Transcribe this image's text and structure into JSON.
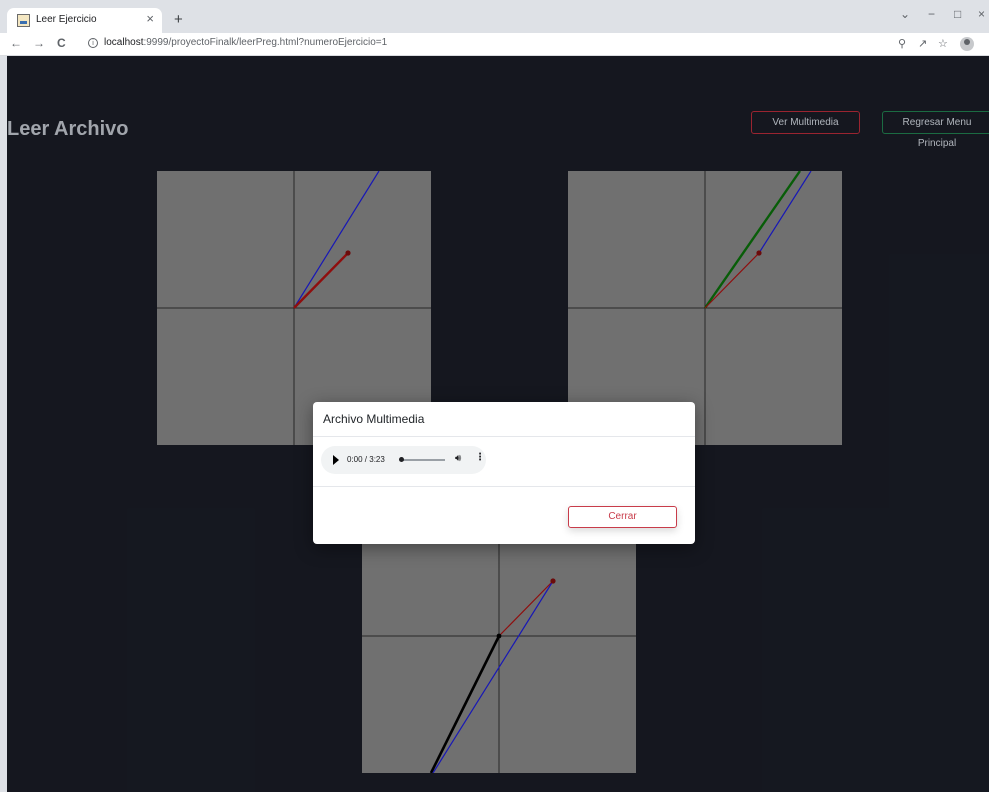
{
  "browser": {
    "tab_title": "Leer Ejercicio",
    "tab_close": "×",
    "new_tab": "+",
    "url_host": "localhost",
    "url_rest": ":9999/proyectoFinalk/leerPreg.html?numeroEjercicio=1",
    "controls": {
      "minimize": "−",
      "maximize": "□",
      "close": "×",
      "dropdown": "⌄"
    },
    "nav": {
      "back": "←",
      "forward": "→",
      "reload": "C"
    }
  },
  "page": {
    "title": "Leer Archivo",
    "btn_multimedia": "Ver Multimedia",
    "btn_menu": "Regresar Menu Principal"
  },
  "modal": {
    "title": "Archivo Multimedia",
    "audio_time": "0:00 / 3:23",
    "close_label": "Cerrar"
  },
  "colors": {
    "page_bg": "#181b24",
    "graph_bg": "#808080",
    "red_vector": "#a31010",
    "blue_vector": "#1b1bd0",
    "green_vector": "#0a6a0a",
    "black_vector": "#000000"
  }
}
